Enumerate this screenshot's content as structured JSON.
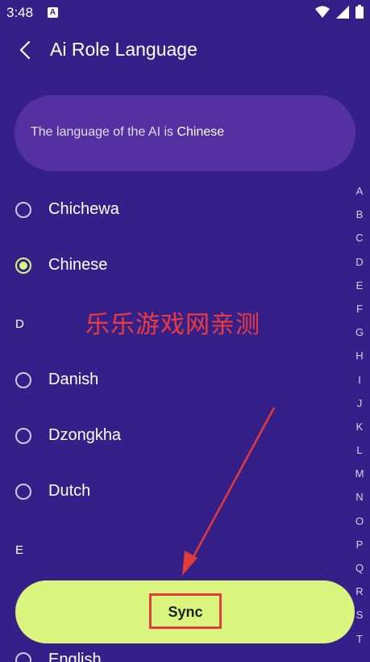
{
  "status_bar": {
    "time": "3:48",
    "notification_icon": "A"
  },
  "app_bar": {
    "title": "Ai Role Language",
    "back_icon": "chevron-left-icon"
  },
  "info_card": {
    "prefix": "The language of the AI is ",
    "current_language": "Chinese"
  },
  "list": {
    "items": [
      {
        "label": "Chichewa",
        "selected": false
      },
      {
        "label": "Chinese",
        "selected": true
      },
      {
        "section": "D"
      },
      {
        "label": "Danish",
        "selected": false
      },
      {
        "label": "Dzongkha",
        "selected": false
      },
      {
        "label": "Dutch",
        "selected": false
      },
      {
        "section": "E"
      },
      {
        "label": "English",
        "selected": false
      }
    ]
  },
  "index_letters": [
    "A",
    "B",
    "C",
    "D",
    "E",
    "F",
    "G",
    "H",
    "I",
    "J",
    "K",
    "L",
    "M",
    "N",
    "O",
    "P",
    "Q",
    "R",
    "S",
    "T"
  ],
  "watermark": "乐乐游戏网亲测",
  "sync_button": {
    "label": "Sync"
  },
  "colors": {
    "background": "#35208a",
    "card": "#5430a0",
    "accent": "#d9f57d",
    "annotation": "#e23b3b"
  }
}
